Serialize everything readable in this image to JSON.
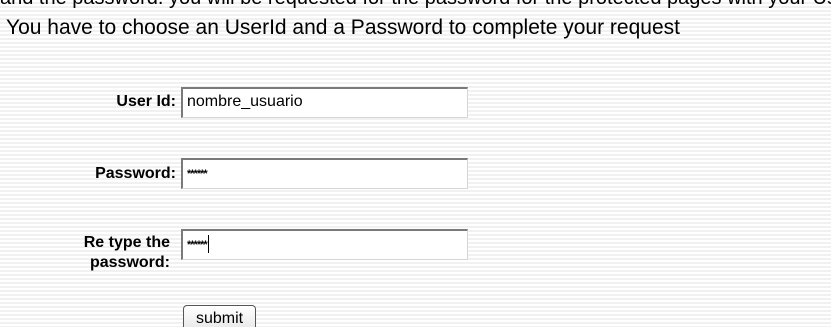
{
  "header": {
    "cut_text": "and the password. you will be requested for the password for the protected pages with your UserId",
    "intro": "You have to choose an UserId and a Password to complete your request"
  },
  "form": {
    "user_id": {
      "label": "User Id:",
      "value": "nombre_usuario"
    },
    "password": {
      "label": "Password:",
      "value": "******"
    },
    "retype": {
      "label_line1": "Re type the",
      "label_line2": "password:",
      "value": "******"
    },
    "submit_label": "submit"
  }
}
